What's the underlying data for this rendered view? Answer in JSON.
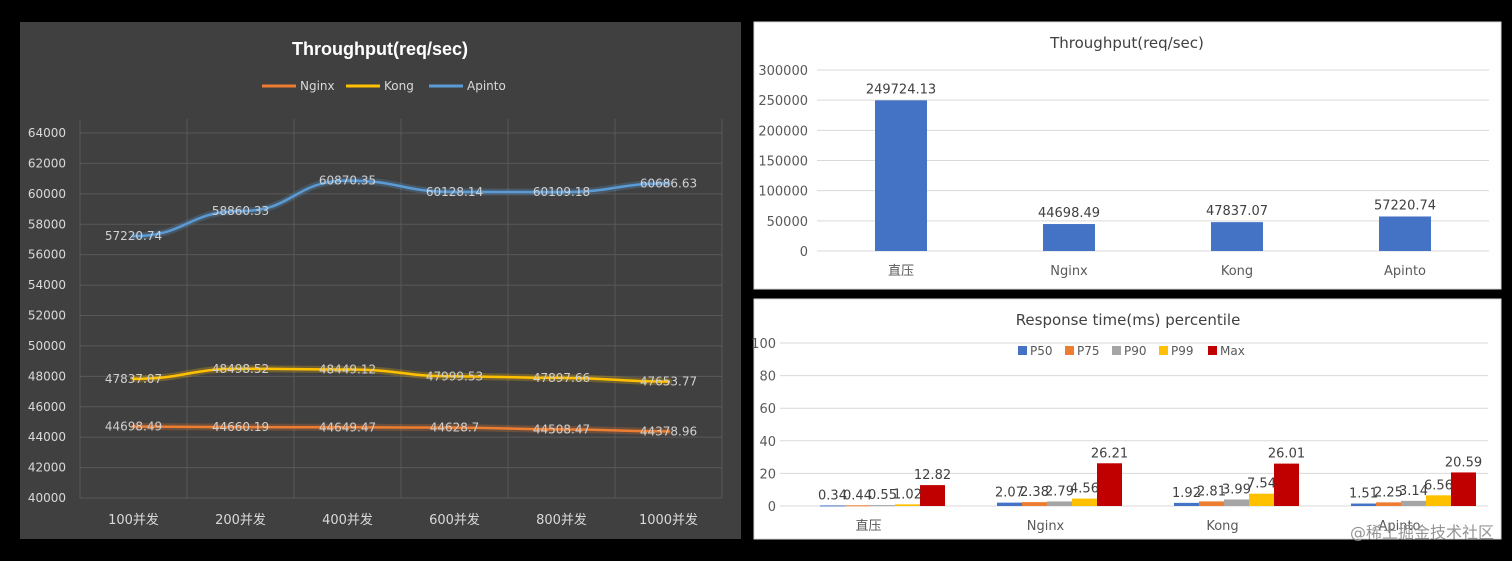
{
  "chart_data": [
    {
      "type": "line",
      "title": "Throughput(req/sec)",
      "categories": [
        "100并发",
        "200并发",
        "400并发",
        "600并发",
        "800并发",
        "1000并发"
      ],
      "ylim": [
        40000,
        64000
      ],
      "yticks": [
        "40000",
        "42000",
        "44000",
        "46000",
        "48000",
        "50000",
        "52000",
        "54000",
        "56000",
        "58000",
        "60000",
        "62000",
        "64000"
      ],
      "grid": true,
      "legend": "top",
      "series": [
        {
          "name": "Nginx",
          "color": "#ED7D31",
          "values": [
            44698.49,
            44660.19,
            44649.47,
            44628.7,
            44508.47,
            44378.96
          ],
          "labels": [
            "44698.49",
            "44660.19",
            "44649.47",
            "44628.7",
            "44508.47",
            "44378.96"
          ]
        },
        {
          "name": "Kong",
          "color": "#FFC000",
          "values": [
            47837.07,
            48498.52,
            48449.12,
            47999.53,
            47897.66,
            47653.77
          ],
          "labels": [
            "47837.07",
            "48498.52",
            "48449.12",
            "47999.53",
            "47897.66",
            "47653.77"
          ]
        },
        {
          "name": "Apinto",
          "color": "#5B9BD5",
          "values": [
            57220.74,
            58860.33,
            60870.35,
            60128.14,
            60109.18,
            60686.63
          ],
          "labels": [
            "57220.74",
            "58860.33",
            "60870.35",
            "60128.14",
            "60109.18",
            "60686.63"
          ]
        }
      ]
    },
    {
      "type": "bar",
      "title": "Throughput(req/sec)",
      "categories": [
        "直压",
        "Nginx",
        "Kong",
        "Apinto"
      ],
      "values": [
        249724.13,
        44698.49,
        47837.07,
        57220.74
      ],
      "labels": [
        "249724.13",
        "44698.49",
        "47837.07",
        "57220.74"
      ],
      "ylim": [
        0,
        300000
      ],
      "yticks": [
        "0",
        "50000",
        "100000",
        "150000",
        "200000",
        "250000",
        "300000"
      ],
      "color": "#4472C4",
      "grid": true
    },
    {
      "type": "bar",
      "title": "Response time(ms) percentile",
      "categories": [
        "直压",
        "Nginx",
        "Kong",
        "Apinto"
      ],
      "ylim": [
        0,
        100
      ],
      "yticks": [
        "0",
        "20",
        "40",
        "60",
        "80",
        "100"
      ],
      "grid": true,
      "legend": "top",
      "series": [
        {
          "name": "P50",
          "color": "#4472C4",
          "values": [
            0.34,
            2.07,
            1.92,
            1.51
          ],
          "labels": [
            "0.34",
            "2.07",
            "1.92",
            "1.51"
          ]
        },
        {
          "name": "P75",
          "color": "#ED7D31",
          "values": [
            0.44,
            2.38,
            2.81,
            2.25
          ],
          "labels": [
            "0.44",
            "2.38",
            "2.81",
            "2.25"
          ]
        },
        {
          "name": "P90",
          "color": "#A5A5A5",
          "values": [
            0.55,
            2.79,
            3.99,
            3.14
          ],
          "labels": [
            "0.55",
            "2.79",
            "3.99",
            "3.14"
          ]
        },
        {
          "name": "P99",
          "color": "#FFC000",
          "values": [
            1.02,
            4.56,
            7.54,
            6.56
          ],
          "labels": [
            "1.02",
            "4.56",
            "7.54",
            "6.56"
          ]
        },
        {
          "name": "Max",
          "color": "#C00000",
          "values": [
            12.82,
            26.21,
            26.01,
            20.59
          ],
          "labels": [
            "12.82",
            "26.21",
            "26.01",
            "20.59"
          ]
        }
      ]
    }
  ],
  "watermark": "@稀土掘金技术社区"
}
